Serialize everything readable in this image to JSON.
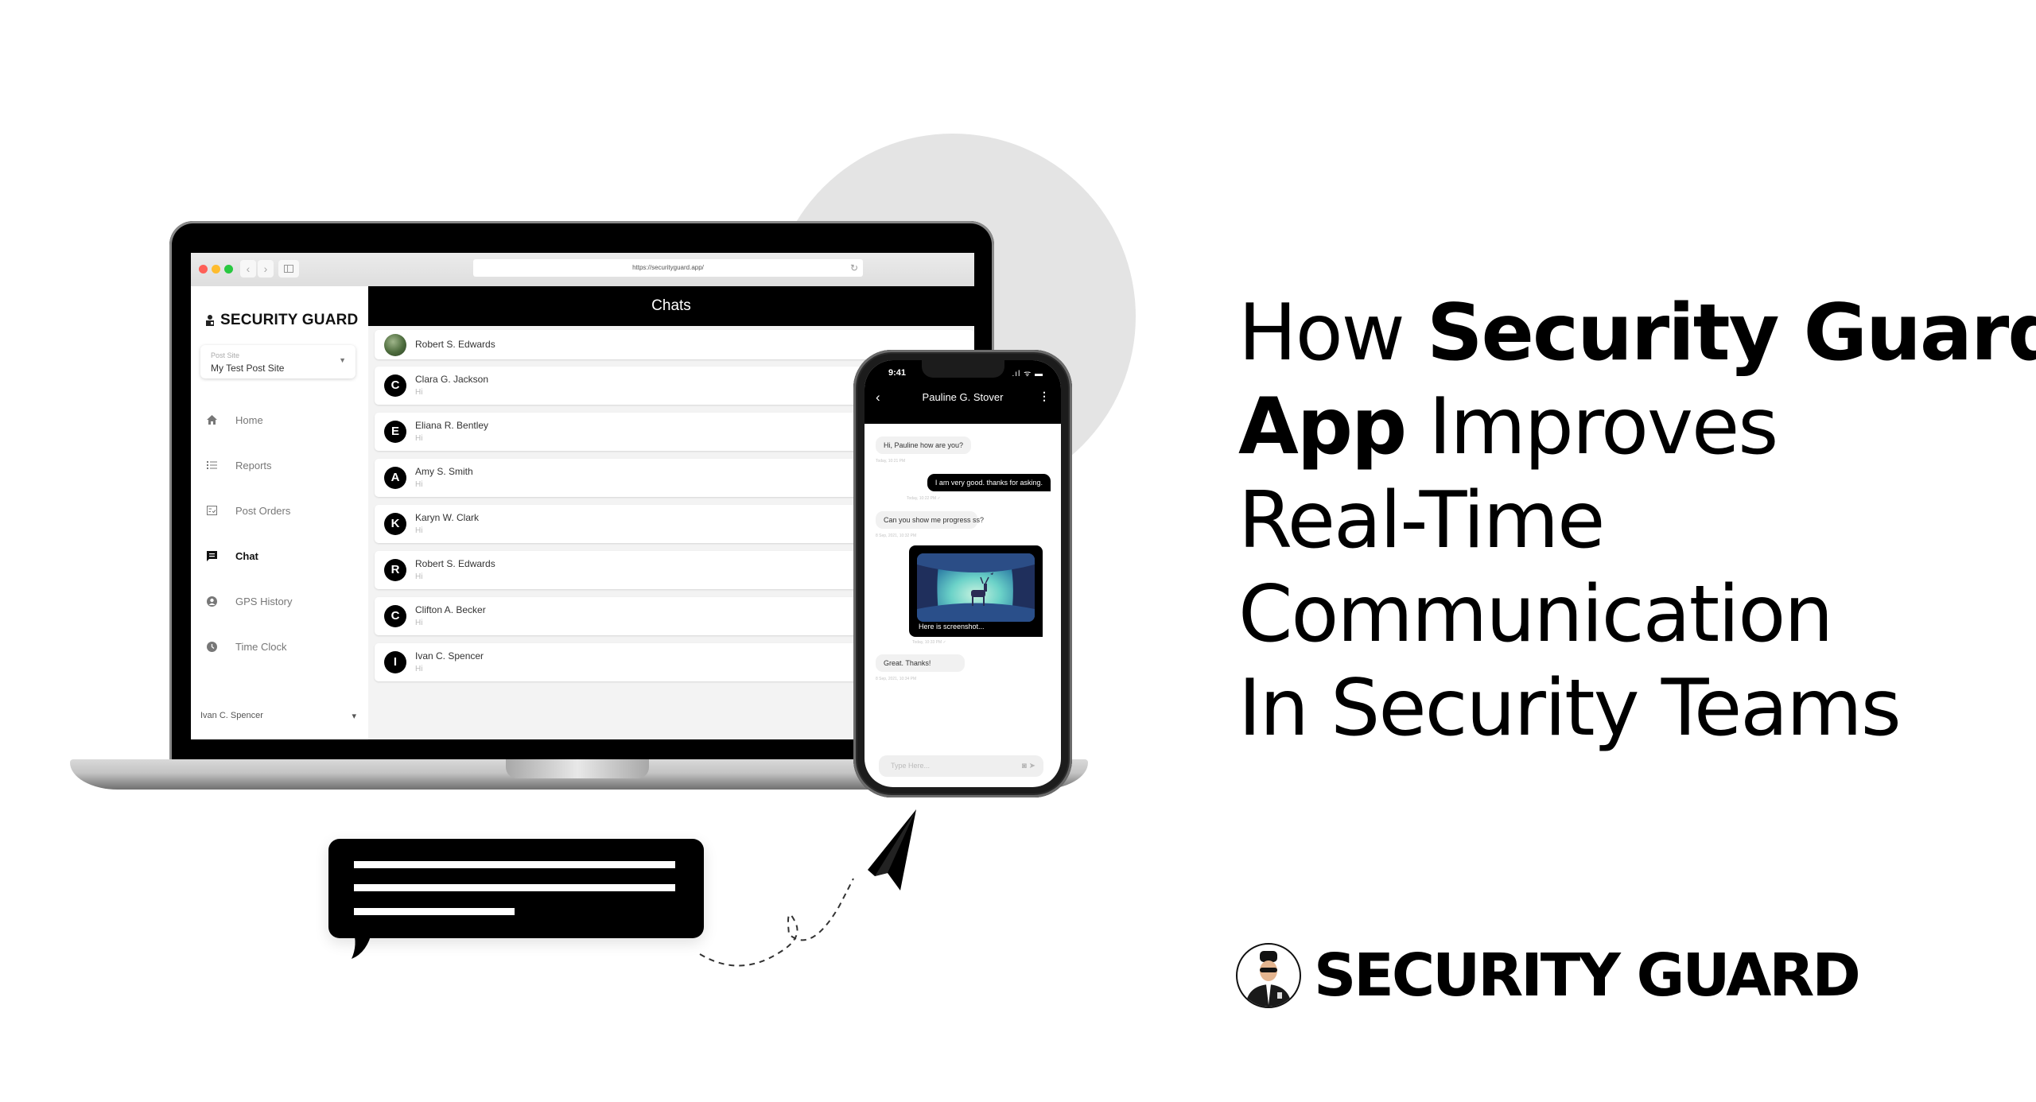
{
  "headline": {
    "parts": [
      {
        "text": "How ",
        "bold": false
      },
      {
        "text": "Security Guard",
        "bold": true
      },
      {
        "text": "App",
        "bold": true
      },
      {
        "text": " Improves",
        "bold": false
      },
      {
        "text": "Real-Time",
        "bold": false
      },
      {
        "text": "Communication",
        "bold": false
      },
      {
        "text": "In Security Teams",
        "bold": false
      }
    ]
  },
  "brand": {
    "name": "SECURITY GUARD"
  },
  "browser": {
    "url": "https://securityguard.app/",
    "back_icon": "‹",
    "forward_icon": "›",
    "window_dots": [
      "#fe5f57",
      "#febc2e",
      "#28c840"
    ]
  },
  "desktop_app": {
    "brand": "SECURITY GUARD",
    "post_site": {
      "label": "Post Site",
      "value": "My Test Post Site"
    },
    "nav": [
      {
        "label": "Home",
        "icon": "home-icon",
        "glyph": "⌂",
        "active": false
      },
      {
        "label": "Reports",
        "icon": "list-icon",
        "glyph": "☰",
        "active": false
      },
      {
        "label": "Post Orders",
        "icon": "checklist-icon",
        "glyph": "☑",
        "active": false
      },
      {
        "label": "Chat",
        "icon": "chat-icon",
        "glyph": "▤",
        "active": true
      },
      {
        "label": "GPS History",
        "icon": "user-location-icon",
        "glyph": "●",
        "active": false
      },
      {
        "label": "Time Clock",
        "icon": "clock-icon",
        "glyph": "◷",
        "active": false
      }
    ],
    "user": {
      "name": "Ivan C. Spencer",
      "caret": "▾"
    },
    "header": "Chats",
    "chats": [
      {
        "name": "Robert S. Edwards",
        "initial": "",
        "message": "",
        "photo": true
      },
      {
        "name": "Clara G. Jackson",
        "initial": "C",
        "message": "Hi",
        "photo": false
      },
      {
        "name": "Eliana R. Bentley",
        "initial": "E",
        "message": "Hi",
        "photo": false
      },
      {
        "name": "Amy S. Smith",
        "initial": "A",
        "message": "Hi",
        "photo": false
      },
      {
        "name": "Karyn W. Clark",
        "initial": "K",
        "message": "Hi",
        "photo": false
      },
      {
        "name": "Robert S. Edwards",
        "initial": "R",
        "message": "Hi",
        "photo": false
      },
      {
        "name": "Clifton A. Becker",
        "initial": "C",
        "message": "Hi",
        "photo": false
      },
      {
        "name": "Ivan C. Spencer",
        "initial": "I",
        "message": "Hi",
        "photo": false
      }
    ]
  },
  "phone_app": {
    "time": "9:41",
    "status_icons": ".ıl ᯤ ▬",
    "contact": "Pauline G. Stover",
    "back_glyph": "‹",
    "menu_glyph": "⋮",
    "messages": [
      {
        "direction": "in",
        "text": "Hi, Pauline how are you?",
        "time": "Today, 10:21 PM"
      },
      {
        "direction": "out",
        "text": "I am very good. thanks for asking.",
        "time": "Today, 10:22 PM ✓"
      },
      {
        "direction": "in",
        "text": "Can you show me progress ss?",
        "time": "8 Sep, 2021, 10:32 PM"
      },
      {
        "direction": "out",
        "type": "image",
        "text": "Here is screenshot...",
        "time": "Today, 10:33 PM ✓"
      },
      {
        "direction": "in",
        "text": "Great. Thanks!",
        "time": "8 Sep, 2021, 10:34 PM"
      }
    ],
    "input_placeholder": "Type Here...",
    "camera_glyph": "◙",
    "send_glyph": "➤"
  },
  "colors": {
    "accent": "#000000",
    "circle_bg": "#e4e4e4",
    "muted_text": "#777777"
  }
}
